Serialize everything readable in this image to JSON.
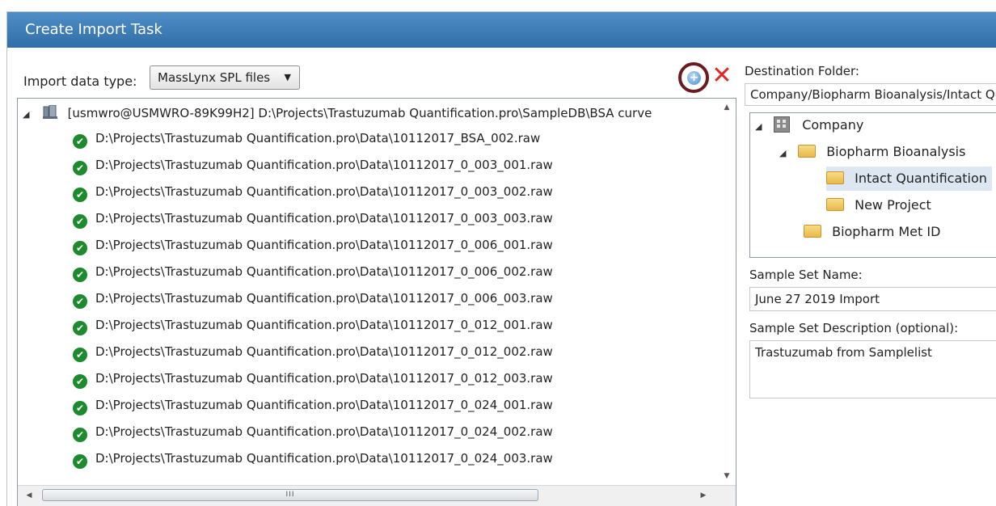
{
  "window": {
    "title": "Create Import Task"
  },
  "import": {
    "label": "Import data type:",
    "selected_type": "MassLynx SPL files"
  },
  "file_tree": {
    "root_label": "[usmwro@USMWRO-89K99H2] D:\\Projects\\Trastuzumab Quantification.pro\\SampleDB\\BSA curve",
    "files": [
      "D:\\Projects\\Trastuzumab Quantification.pro\\Data\\10112017_BSA_002.raw",
      "D:\\Projects\\Trastuzumab Quantification.pro\\Data\\10112017_0_003_001.raw",
      "D:\\Projects\\Trastuzumab Quantification.pro\\Data\\10112017_0_003_002.raw",
      "D:\\Projects\\Trastuzumab Quantification.pro\\Data\\10112017_0_003_003.raw",
      "D:\\Projects\\Trastuzumab Quantification.pro\\Data\\10112017_0_006_001.raw",
      "D:\\Projects\\Trastuzumab Quantification.pro\\Data\\10112017_0_006_002.raw",
      "D:\\Projects\\Trastuzumab Quantification.pro\\Data\\10112017_0_006_003.raw",
      "D:\\Projects\\Trastuzumab Quantification.pro\\Data\\10112017_0_012_001.raw",
      "D:\\Projects\\Trastuzumab Quantification.pro\\Data\\10112017_0_012_002.raw",
      "D:\\Projects\\Trastuzumab Quantification.pro\\Data\\10112017_0_012_003.raw",
      "D:\\Projects\\Trastuzumab Quantification.pro\\Data\\10112017_0_024_001.raw",
      "D:\\Projects\\Trastuzumab Quantification.pro\\Data\\10112017_0_024_002.raw",
      "D:\\Projects\\Trastuzumab Quantification.pro\\Data\\10112017_0_024_003.raw"
    ],
    "scroll_thumb_grip": "III"
  },
  "destination": {
    "label": "Destination Folder:",
    "path": "Company/Biopharm Bioanalysis/Intact Quantification",
    "folders": {
      "company": "Company",
      "biopharm_bioanalysis": "Biopharm Bioanalysis",
      "intact_quantification": "Intact Quantification",
      "new_project": "New Project",
      "biopharm_met_id": "Biopharm Met ID"
    }
  },
  "sample_set": {
    "name_label": "Sample Set Name:",
    "name_value": "June 27 2019 Import",
    "description_label": "Sample Set Description (optional):",
    "description_value": "Trastuzumab from Samplelist"
  },
  "icons": {
    "add": "add-icon",
    "remove": "remove-icon",
    "server": "server-icon",
    "check": "check-circle-icon",
    "folder": "folder-icon",
    "company": "building-icon"
  },
  "colors": {
    "titlebar": "#3a7bb7",
    "check": "#1d8a2d",
    "remove": "#e02525",
    "selection": "#dde7f1"
  }
}
